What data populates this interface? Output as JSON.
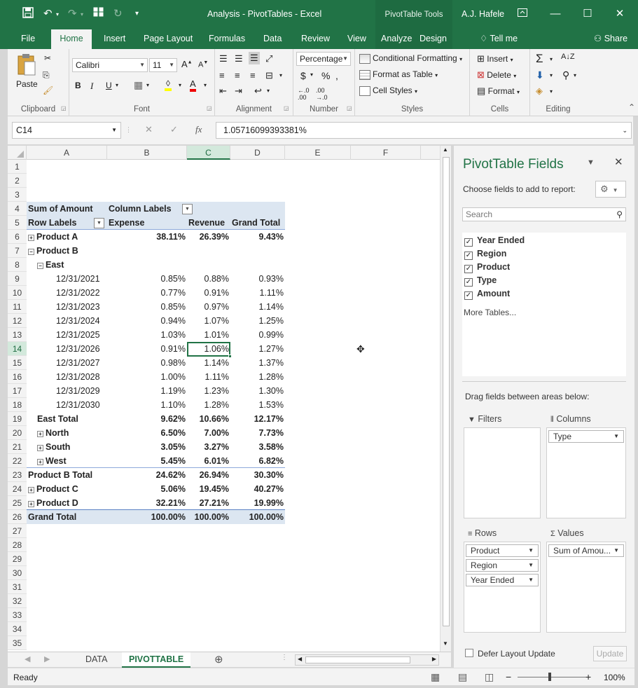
{
  "title": {
    "text": "Analysis - PivotTables - Excel",
    "context": "PivotTable Tools",
    "user": "A.J. Hafele"
  },
  "tabs": [
    "File",
    "Home",
    "Insert",
    "Page Layout",
    "Formulas",
    "Data",
    "Review",
    "View",
    "Analyze",
    "Design"
  ],
  "tell_me": "Tell me",
  "share": "Share",
  "ribbon": {
    "clipboard": {
      "paste": "Paste",
      "label": "Clipboard"
    },
    "font": {
      "name": "Calibri",
      "size": "11",
      "label": "Font"
    },
    "alignment": {
      "label": "Alignment"
    },
    "number": {
      "format": "Percentage",
      "label": "Number"
    },
    "styles": {
      "conditional": "Conditional Formatting",
      "format_table": "Format as Table",
      "cell_styles": "Cell Styles",
      "label": "Styles"
    },
    "cells": {
      "insert": "Insert",
      "delete": "Delete",
      "format": "Format",
      "label": "Cells"
    },
    "editing": {
      "label": "Editing"
    }
  },
  "formula_bar": {
    "namebox": "C14",
    "value": "1.05716099393381%"
  },
  "columns": [
    "A",
    "B",
    "C",
    "D",
    "E",
    "F"
  ],
  "rows": [
    "1",
    "2",
    "3",
    "4",
    "5",
    "6",
    "7",
    "8",
    "9",
    "10",
    "11",
    "12",
    "13",
    "14",
    "15",
    "16",
    "17",
    "18",
    "19",
    "20",
    "21",
    "22",
    "23",
    "24",
    "25",
    "26",
    "27",
    "28",
    "29",
    "30",
    "31",
    "32",
    "33",
    "34",
    "35"
  ],
  "pivot": {
    "sum_label": "Sum of Amount",
    "column_labels": "Column Labels",
    "row_labels": "Row Labels",
    "headers": [
      "Expense",
      "Revenue",
      "Grand Total"
    ],
    "data": [
      {
        "row": 6,
        "label": "Product A",
        "indent": 0,
        "bold": true,
        "toggle": "+",
        "values": [
          "38.11%",
          "26.39%",
          "9.43%"
        ]
      },
      {
        "row": 7,
        "label": "Product B",
        "indent": 0,
        "bold": true,
        "toggle": "-",
        "values": [
          "",
          "",
          ""
        ]
      },
      {
        "row": 8,
        "label": "East",
        "indent": 1,
        "bold": true,
        "toggle": "-",
        "values": [
          "",
          "",
          ""
        ]
      },
      {
        "row": 9,
        "label": "12/31/2021",
        "indent": 2,
        "bold": false,
        "toggle": "",
        "values": [
          "0.85%",
          "0.88%",
          "0.93%"
        ]
      },
      {
        "row": 10,
        "label": "12/31/2022",
        "indent": 2,
        "bold": false,
        "toggle": "",
        "values": [
          "0.77%",
          "0.91%",
          "1.11%"
        ]
      },
      {
        "row": 11,
        "label": "12/31/2023",
        "indent": 2,
        "bold": false,
        "toggle": "",
        "values": [
          "0.85%",
          "0.97%",
          "1.14%"
        ]
      },
      {
        "row": 12,
        "label": "12/31/2024",
        "indent": 2,
        "bold": false,
        "toggle": "",
        "values": [
          "0.94%",
          "1.07%",
          "1.25%"
        ]
      },
      {
        "row": 13,
        "label": "12/31/2025",
        "indent": 2,
        "bold": false,
        "toggle": "",
        "values": [
          "1.03%",
          "1.01%",
          "0.99%"
        ]
      },
      {
        "row": 14,
        "label": "12/31/2026",
        "indent": 2,
        "bold": false,
        "toggle": "",
        "values": [
          "0.91%",
          "1.06%",
          "1.27%"
        ]
      },
      {
        "row": 15,
        "label": "12/31/2027",
        "indent": 2,
        "bold": false,
        "toggle": "",
        "values": [
          "0.98%",
          "1.14%",
          "1.37%"
        ]
      },
      {
        "row": 16,
        "label": "12/31/2028",
        "indent": 2,
        "bold": false,
        "toggle": "",
        "values": [
          "1.00%",
          "1.11%",
          "1.28%"
        ]
      },
      {
        "row": 17,
        "label": "12/31/2029",
        "indent": 2,
        "bold": false,
        "toggle": "",
        "values": [
          "1.19%",
          "1.23%",
          "1.30%"
        ]
      },
      {
        "row": 18,
        "label": "12/31/2030",
        "indent": 2,
        "bold": false,
        "toggle": "",
        "values": [
          "1.10%",
          "1.28%",
          "1.53%"
        ]
      },
      {
        "row": 19,
        "label": "East Total",
        "indent": 1,
        "bold": true,
        "toggle": "",
        "values": [
          "9.62%",
          "10.66%",
          "12.17%"
        ]
      },
      {
        "row": 20,
        "label": "North",
        "indent": 1,
        "bold": true,
        "toggle": "+",
        "values": [
          "6.50%",
          "7.00%",
          "7.73%"
        ]
      },
      {
        "row": 21,
        "label": "South",
        "indent": 1,
        "bold": true,
        "toggle": "+",
        "values": [
          "3.05%",
          "3.27%",
          "3.58%"
        ]
      },
      {
        "row": 22,
        "label": "West",
        "indent": 1,
        "bold": true,
        "toggle": "+",
        "values": [
          "5.45%",
          "6.01%",
          "6.82%"
        ]
      },
      {
        "row": 23,
        "label": "Product B Total",
        "indent": 0,
        "bold": true,
        "toggle": "",
        "values": [
          "24.62%",
          "26.94%",
          "30.30%"
        ]
      },
      {
        "row": 24,
        "label": "Product C",
        "indent": 0,
        "bold": true,
        "toggle": "+",
        "values": [
          "5.06%",
          "19.45%",
          "40.27%"
        ]
      },
      {
        "row": 25,
        "label": "Product D",
        "indent": 0,
        "bold": true,
        "toggle": "+",
        "values": [
          "32.21%",
          "27.21%",
          "19.99%"
        ]
      },
      {
        "row": 26,
        "label": "Grand Total",
        "indent": 0,
        "bold": true,
        "toggle": "",
        "values": [
          "100.00%",
          "100.00%",
          "100.00%"
        ]
      }
    ]
  },
  "sheet_tabs": [
    "DATA",
    "PIVOTTABLE"
  ],
  "status": {
    "ready": "Ready",
    "zoom": "100%"
  },
  "pane": {
    "title": "PivotTable Fields",
    "subtitle": "Choose fields to add to report:",
    "search_placeholder": "Search",
    "fields": [
      "Year Ended",
      "Region",
      "Product",
      "Type",
      "Amount"
    ],
    "more_tables": "More Tables...",
    "drag_label": "Drag fields between areas below:",
    "filters": "Filters",
    "columns": "Columns",
    "rows": "Rows",
    "values": "Values",
    "columns_items": [
      "Type"
    ],
    "rows_items": [
      "Product",
      "Region",
      "Year Ended"
    ],
    "values_items": [
      "Sum of Amou..."
    ],
    "defer": "Defer Layout Update",
    "update": "Update"
  },
  "colors": {
    "accent": "#217346",
    "header_band": "#dce6f1"
  }
}
